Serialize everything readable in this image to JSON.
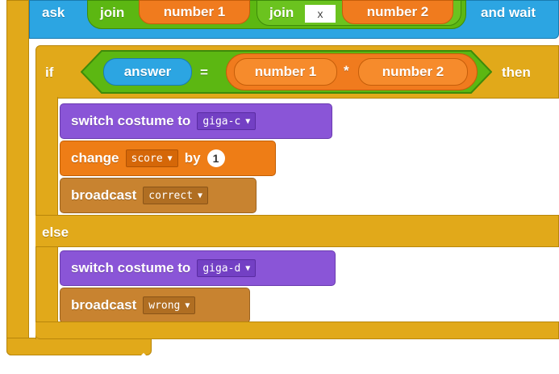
{
  "ask_block": {
    "ask_label": "ask",
    "join_outer_label": "join",
    "join_inner_label": "join",
    "operand_1": "number 1",
    "text_value": "x",
    "operand_2": "number 2",
    "and_wait_label": "and wait"
  },
  "if_block": {
    "if_label": "if",
    "then_label": "then",
    "else_label": "else",
    "condition": {
      "left": "answer",
      "equals_op": "=",
      "multiply_left": "number 1",
      "multiply_op": "*",
      "multiply_right": "number 2"
    }
  },
  "then_branch": {
    "switch_costume_label": "switch costume to",
    "costume_value": "giga-c",
    "change_label": "change",
    "variable_value": "score",
    "by_label": "by",
    "change_amount": "1",
    "broadcast_label": "broadcast",
    "broadcast_value": "correct"
  },
  "else_branch": {
    "switch_costume_label": "switch costume to",
    "costume_value": "giga-d",
    "broadcast_label": "broadcast",
    "broadcast_value": "wrong"
  },
  "colors": {
    "control": "#e1a91a",
    "sensing": "#2ca5e2",
    "operators": "#5cb712",
    "looks": "#8a55d7",
    "data": "#ee7d16",
    "events": "#c88330"
  },
  "icons": {
    "loop_end": "return-arrow-icon",
    "dropdown": "triangle-down-icon"
  }
}
